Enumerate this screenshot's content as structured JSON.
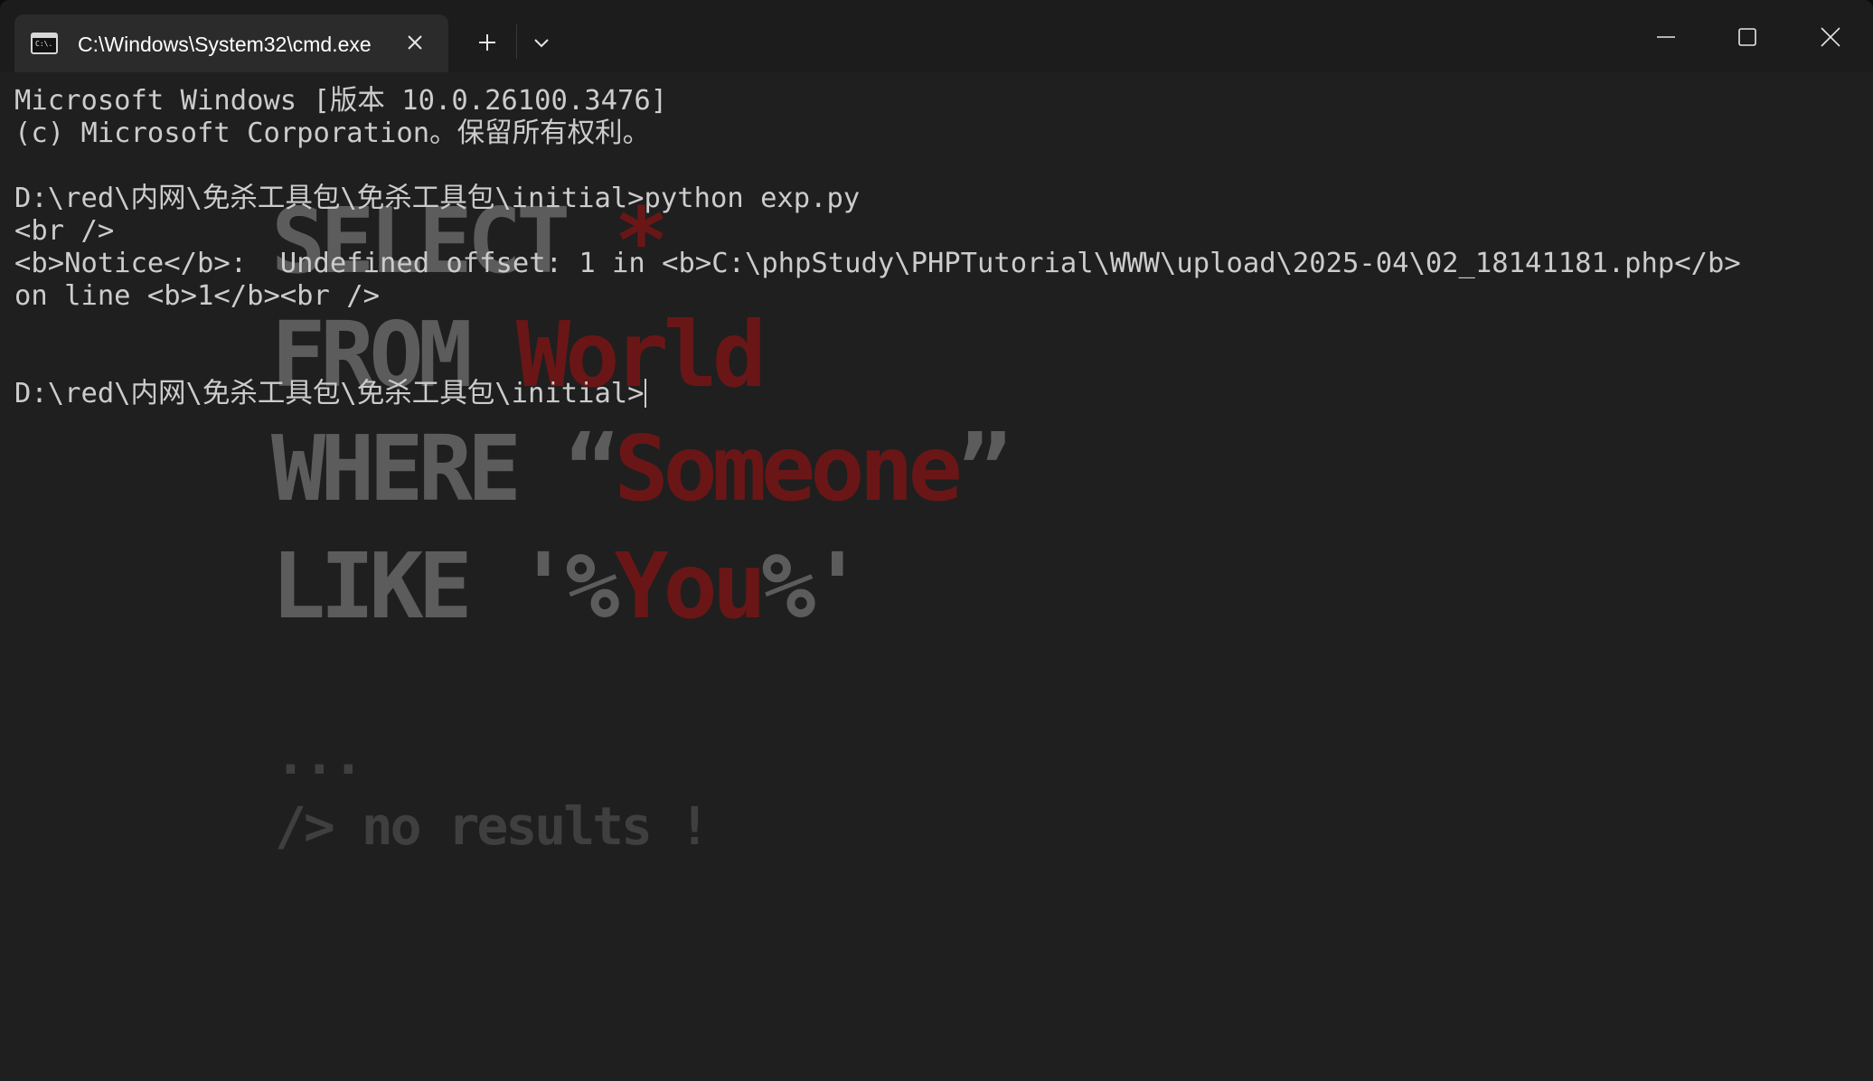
{
  "window": {
    "tab_title": "C:\\Windows\\System32\\cmd.exe",
    "tab_icon": "command-prompt-icon",
    "tab_icon_text": "C:\\.",
    "new_tab_icon": "plus-icon",
    "dropdown_icon": "chevron-down-icon",
    "minimize_icon": "minimize-icon",
    "maximize_icon": "maximize-icon",
    "close_icon": "close-icon"
  },
  "console": {
    "lines": [
      "Microsoft Windows [版本 10.0.26100.3476]",
      "(c) Microsoft Corporation。保留所有权利。",
      "",
      "D:\\red\\内网\\免杀工具包\\免杀工具包\\initial>python exp.py",
      "<br />",
      "<b>Notice</b>:  Undefined offset: 1 in <b>C:\\phpStudy\\PHPTutorial\\WWW\\upload\\2025-04\\02_18141181.php</b>",
      "on line <b>1</b><br />",
      "",
      "",
      "D:\\red\\内网\\免杀工具包\\免杀工具包\\initial>"
    ]
  },
  "wallpaper": {
    "line1_a": "SELECT ",
    "line1_b": "*",
    "line2_a": "FROM ",
    "line2_b": "World",
    "line3_a": "WHERE “",
    "line3_b": "Someone",
    "line3_c": "”",
    "line4_a": "LIKE '%",
    "line4_b": "You",
    "line4_c": "%'",
    "ellipsis": "...",
    "footer": "/> no results !"
  },
  "colors": {
    "background": "#1f1f1f",
    "text": "#cccccc",
    "accent_red": "#6a1616",
    "watermark_gray": "#5c5c5c"
  }
}
